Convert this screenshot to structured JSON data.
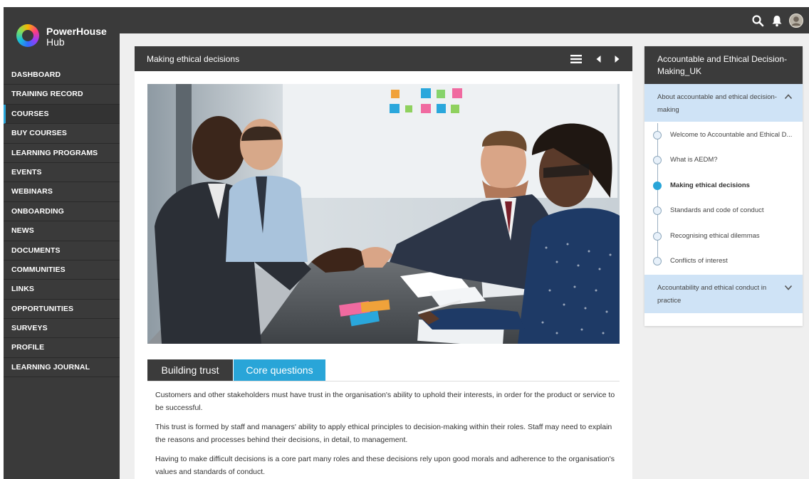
{
  "app": {
    "logo_name": "PowerHouse",
    "logo_sub": "Hub"
  },
  "sidebar": {
    "items": [
      {
        "label": "DASHBOARD"
      },
      {
        "label": "TRAINING RECORD"
      },
      {
        "label": "COURSES",
        "active": true
      },
      {
        "label": "BUY COURSES"
      },
      {
        "label": "LEARNING PROGRAMS"
      },
      {
        "label": "EVENTS"
      },
      {
        "label": "WEBINARS"
      },
      {
        "label": "ONBOARDING"
      },
      {
        "label": "NEWS"
      },
      {
        "label": "DOCUMENTS"
      },
      {
        "label": "COMMUNITIES"
      },
      {
        "label": "LINKS"
      },
      {
        "label": "OPPORTUNITIES"
      },
      {
        "label": "SURVEYS"
      },
      {
        "label": "PROFILE"
      },
      {
        "label": "LEARNING JOURNAL"
      }
    ]
  },
  "header": {
    "icons": [
      "search-icon",
      "bell-icon",
      "avatar"
    ]
  },
  "lesson": {
    "title": "Making ethical decisions",
    "controls": [
      "menu-icon",
      "prev-icon",
      "next-icon"
    ],
    "tabs": [
      {
        "label": "Building trust"
      },
      {
        "label": "Core questions"
      }
    ],
    "paragraphs": [
      "Customers and other stakeholders must have trust in the organisation's ability to uphold their interests, in order for the product or service to be successful.",
      "This trust is formed by staff and managers' ability to apply ethical principles to decision-making within their roles. Staff may need to explain the reasons and processes behind their decisions, in detail, to management.",
      "Having to make difficult decisions is a core part many roles and these decisions rely upon good morals and adherence to the organisation's values and standards of conduct."
    ]
  },
  "toc": {
    "course_title": "Accountable and Ethical Decision-Making_UK",
    "sections": [
      {
        "title": "About accountable and ethical decision-making",
        "expanded": true,
        "items": [
          {
            "label": "Welcome to Accountable and Ethical D..."
          },
          {
            "label": "What is AEDM?"
          },
          {
            "label": "Making ethical decisions",
            "current": true
          },
          {
            "label": "Standards and code of conduct"
          },
          {
            "label": "Recognising ethical dilemmas"
          },
          {
            "label": "Conflicts of interest"
          }
        ]
      },
      {
        "title": "Accountability and ethical conduct in practice",
        "expanded": false
      }
    ]
  },
  "colors": {
    "dark": "#3b3b3b",
    "accent": "#29a5d8",
    "toc_section_bg": "#cfe3f6",
    "main_bg": "#efefef"
  }
}
